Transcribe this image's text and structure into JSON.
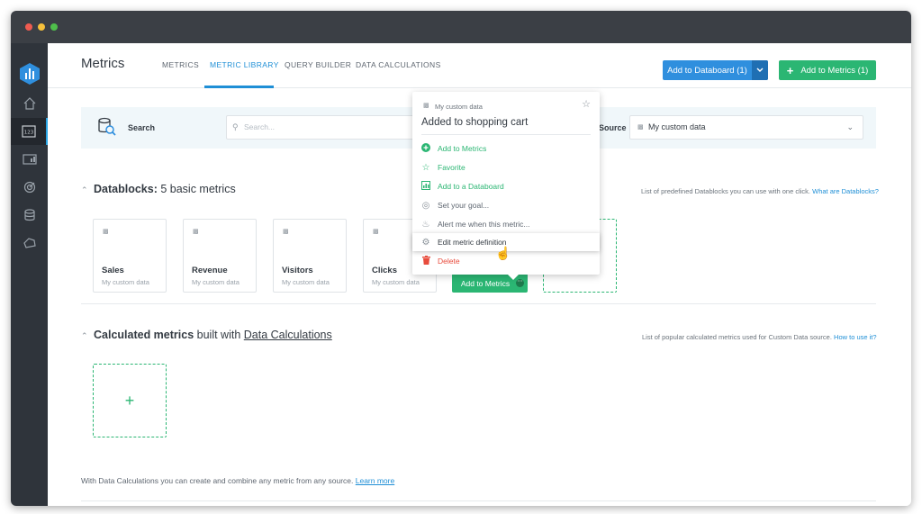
{
  "header": {
    "title": "Metrics",
    "tabs": [
      {
        "label": "METRICS",
        "active": false
      },
      {
        "label": "METRIC LIBRARY",
        "active": true
      },
      {
        "label": "QUERY BUILDER",
        "active": false
      },
      {
        "label": "DATA CALCULATIONS",
        "active": false
      }
    ],
    "add_to_databoard_label": "Add to Databoard (1)",
    "add_to_metrics_label": "Add to Metrics (1)"
  },
  "search": {
    "label": "Search",
    "placeholder": "Search...",
    "source_label": "Source",
    "source_value": "My custom data"
  },
  "datablocks": {
    "title_bold": "Datablocks:",
    "title_rest": "5 basic metrics",
    "note": "List of predefined Datablocks you can use with one click.",
    "note_link": "What are Datablocks?",
    "cards": [
      {
        "name": "Sales",
        "sub": "My custom data"
      },
      {
        "name": "Revenue",
        "sub": "My custom data"
      },
      {
        "name": "Visitors",
        "sub": "My custom data"
      },
      {
        "name": "Clicks",
        "sub": "My custom data"
      }
    ],
    "add_button_label": "Add to Metrics"
  },
  "calculated": {
    "title_bold": "Calculated metrics",
    "title_rest": "built with",
    "title_link": "Data Calculations",
    "note": "List of popular calculated metrics used for Custom Data source.",
    "note_link": "How to use it?",
    "add_symbol": "+"
  },
  "footer": {
    "text": "With Data Calculations you can create and combine any metric from any source.",
    "link": "Learn more"
  },
  "popup": {
    "source": "My custom data",
    "title": "Added to shopping cart",
    "items": [
      {
        "label": "Add to Metrics",
        "icon": "plus-circle-icon",
        "style": "green"
      },
      {
        "label": "Favorite",
        "icon": "star-icon",
        "style": "green"
      },
      {
        "label": "Add to a Databoard",
        "icon": "databoard-icon",
        "style": "green"
      },
      {
        "label": "Set your goal...",
        "icon": "goal-icon",
        "style": "gray"
      },
      {
        "label": "Alert me when this metric...",
        "icon": "bell-icon",
        "style": "gray"
      },
      {
        "label": "Edit metric definition",
        "icon": "gear-icon",
        "style": "hover"
      },
      {
        "label": "Delete",
        "icon": "trash-icon",
        "style": "red"
      }
    ]
  },
  "colors": {
    "brand_blue": "#2f8fde",
    "brand_green": "#2bb673",
    "danger_red": "#e84c3d",
    "sidebar_bg": "#2f343b"
  }
}
